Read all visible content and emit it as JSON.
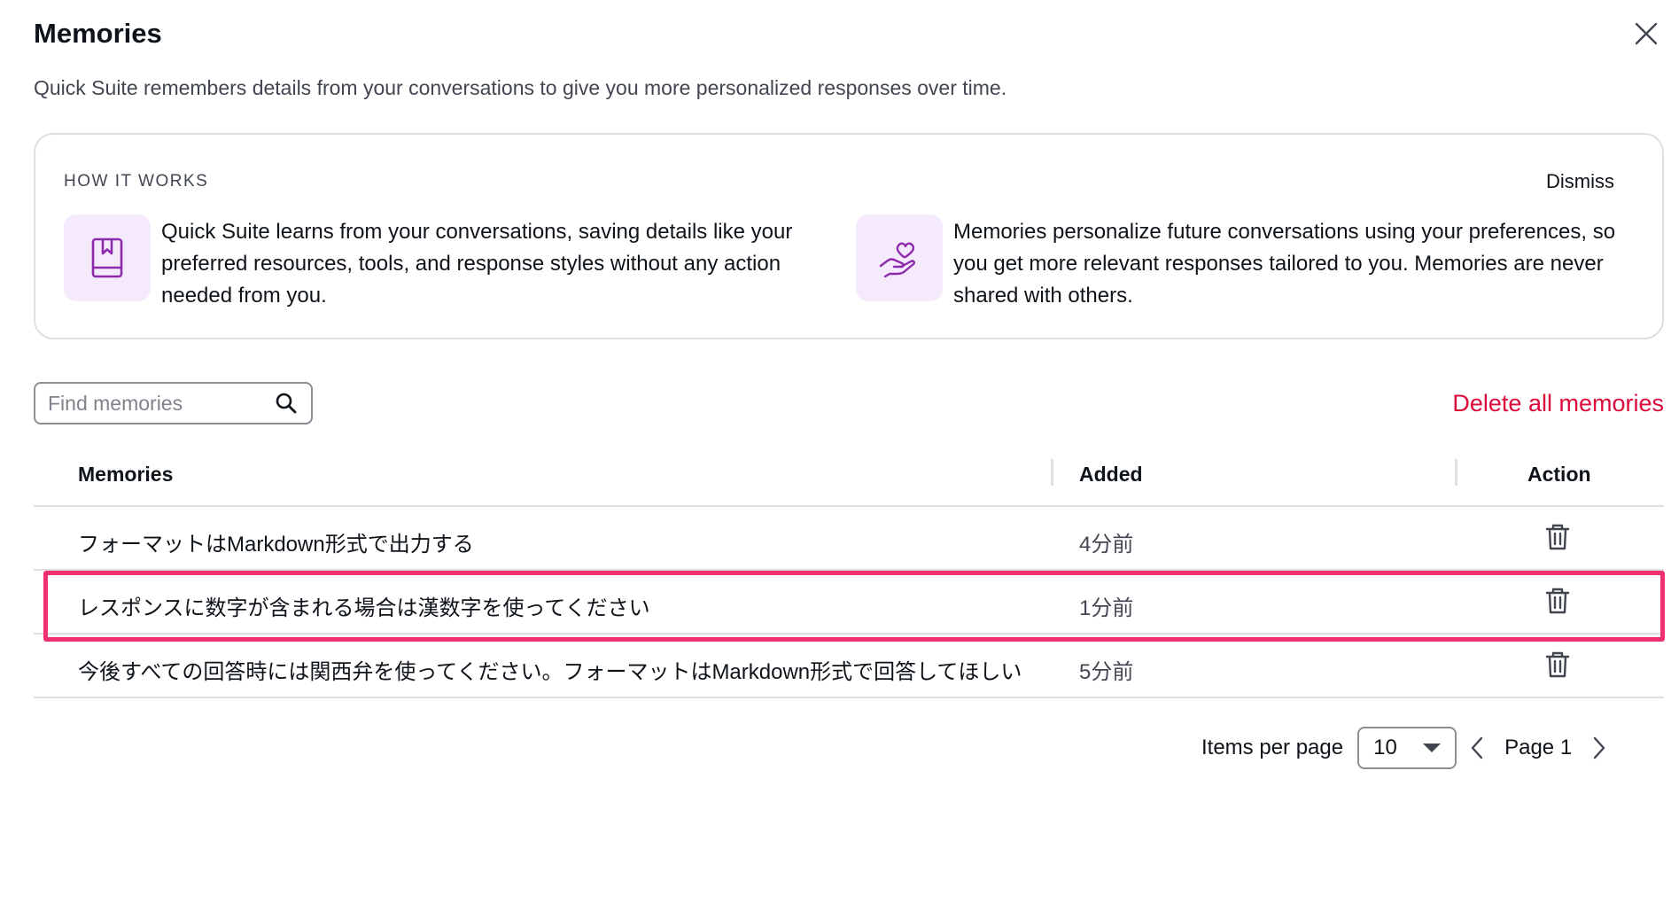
{
  "header": {
    "title": "Memories",
    "subtitle": "Quick Suite remembers details from your conversations to give you more personalized responses over time."
  },
  "info_card": {
    "label": "HOW IT WORKS",
    "dismiss_label": "Dismiss",
    "features": [
      {
        "icon": "bookmark-book-icon",
        "text": "Quick Suite learns from your conversations, saving details like your preferred resources, tools, and response styles without any action needed from you."
      },
      {
        "icon": "heart-hand-icon",
        "text": "Memories personalize future conversations using your preferences, so you get more relevant responses tailored to you. Memories are never shared with others."
      }
    ]
  },
  "search": {
    "placeholder": "Find memories",
    "value": ""
  },
  "delete_all_label": "Delete all memories",
  "table": {
    "columns": [
      "Memories",
      "Added",
      "Action"
    ],
    "rows": [
      {
        "memory": "フォーマットはMarkdown形式で出力する",
        "added": "4分前"
      },
      {
        "memory": "レスポンスに数字が含まれる場合は漢数字を使ってください",
        "added": "1分前",
        "highlighted": true
      },
      {
        "memory": "今後すべての回答時には関西弁を使ってください。フォーマットはMarkdown形式で回答してほしい",
        "added": "5分前"
      }
    ]
  },
  "pagination": {
    "items_per_page_label": "Items per page",
    "items_per_page_value": "10",
    "page_label": "Page 1"
  },
  "colors": {
    "accent_purple": "#f4eafb",
    "icon_purple": "#8d2bad",
    "danger": "#db0a3a",
    "highlight": "#f0306f"
  }
}
